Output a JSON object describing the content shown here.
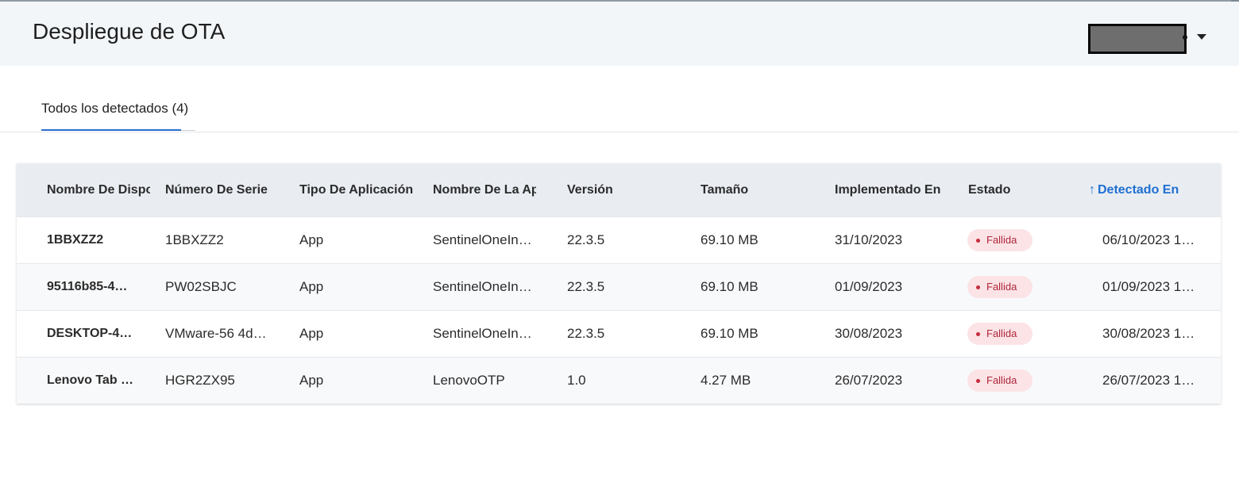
{
  "header": {
    "title": "Despliegue de OTA"
  },
  "tabs": [
    {
      "label": "Todos los detectados (4)",
      "active": true
    }
  ],
  "table": {
    "columns": [
      "Nombre De Dispositivo",
      "Número De Serie",
      "Tipo De Aplicación",
      "Nombre De La Aplicación",
      "Versión",
      "Tamaño",
      "Implementado En",
      "Estado",
      "Detectado En"
    ],
    "sorted_column": "Detectado En",
    "sort_direction": "asc",
    "rows": [
      {
        "device": "1BBXZZ2",
        "serial": "1BBXZZ2",
        "app_type": "App",
        "app_name": "SentinelOneIns…",
        "version": "22.3.5",
        "size": "69.10 MB",
        "deployed": "31/10/2023",
        "status": "Fallida",
        "detected": "06/10/2023 1…"
      },
      {
        "device": "95116b85-4…",
        "serial": "PW02SBJC",
        "app_type": "App",
        "app_name": "SentinelOneIns…",
        "version": "22.3.5",
        "size": "69.10 MB",
        "deployed": "01/09/2023",
        "status": "Fallida",
        "detected": "01/09/2023 1…"
      },
      {
        "device": "DESKTOP-4…",
        "serial": "VMware-56 4d …",
        "app_type": "App",
        "app_name": "SentinelOneIns…",
        "version": "22.3.5",
        "size": "69.10 MB",
        "deployed": "30/08/2023",
        "status": "Fallida",
        "detected": "30/08/2023 1…"
      },
      {
        "device": "Lenovo Tab …",
        "serial": "HGR2ZX95",
        "app_type": "App",
        "app_name": "LenovoOTP",
        "version": "1.0",
        "size": "4.27 MB",
        "deployed": "26/07/2023",
        "status": "Fallida",
        "detected": "26/07/2023 1…"
      }
    ]
  },
  "colors": {
    "accent": "#1f6fd1",
    "header_bg": "#f2f6f9",
    "table_header_bg": "#e9edf2",
    "status_failed_bg": "#fbe3e6",
    "status_failed_text": "#b0263a"
  },
  "icons": {
    "sort": "arrow-up-icon",
    "user_menu": "caret-down-icon"
  }
}
